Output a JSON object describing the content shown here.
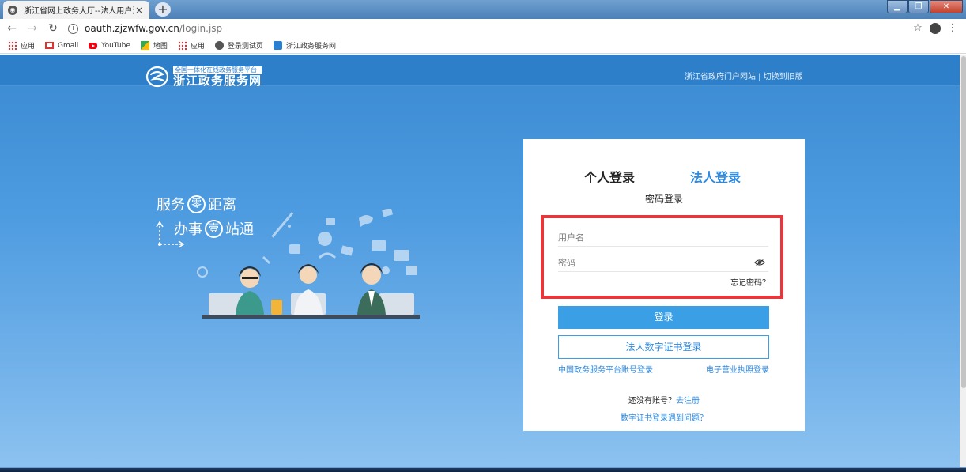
{
  "browser": {
    "tab_title": "浙江省网上政务大厅--法人用户注",
    "tab_close": "×",
    "new_tab": "+",
    "window_title": "",
    "url_domain": "oauth.zjzwfw.gov.cn",
    "url_path": "/login.jsp",
    "bookmarks": [
      {
        "label": "应用",
        "icon": "apps-icon"
      },
      {
        "label": "Gmail",
        "icon": "gmail-icon"
      },
      {
        "label": "YouTube",
        "icon": "youtube-icon"
      },
      {
        "label": "地图",
        "icon": "maps-icon"
      },
      {
        "label": "应用",
        "icon": "apps-icon"
      },
      {
        "label": "登录测试页",
        "icon": "globe-icon"
      },
      {
        "label": "浙江政务服务网",
        "icon": "zjzwfw-icon"
      }
    ]
  },
  "header": {
    "logo_tagline": "全国一体化在线政务服务平台",
    "logo_name": "浙江政务服务网",
    "portal_link": "浙江省政府门户网站",
    "separator": " | ",
    "old_version_link": "切换到旧版"
  },
  "slogan": {
    "line1_a": "服务",
    "line1_circle": "零",
    "line1_b": "距离",
    "line2_a": "办事",
    "line2_circle": "壹",
    "line2_b": "站通"
  },
  "login": {
    "tab_personal": "个人登录",
    "tab_corporate": "法人登录",
    "subtitle": "密码登录",
    "username_placeholder": "用户名",
    "password_placeholder": "密码",
    "forgot_password": "忘记密码？",
    "login_button": "登录",
    "cert_button": "法人数字证书登录",
    "national_link": "中国政务服务平台账号登录",
    "license_link": "电子营业执照登录",
    "no_account": "还没有账号？",
    "register_link": "去注册",
    "cert_help": "数字证书登录遇到问题？"
  },
  "colors": {
    "accent": "#2d8ae0",
    "button": "#3b9fe6",
    "highlight": "#e4393c",
    "header": "#2d7fc9"
  }
}
